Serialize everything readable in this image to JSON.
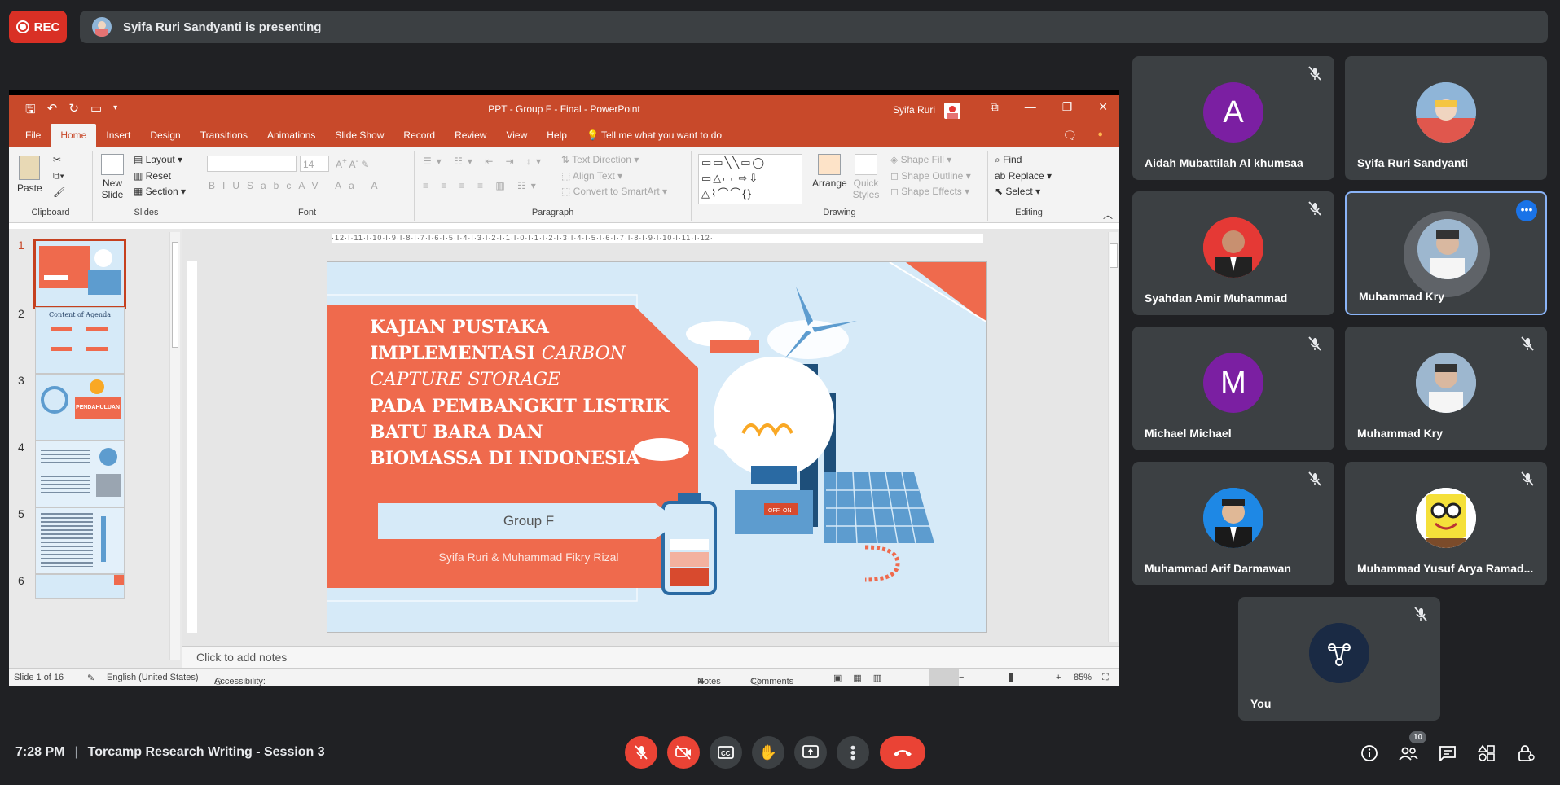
{
  "topbar": {
    "rec_label": "REC",
    "presenting_text": "Syifa Ruri Sandyanti is presenting"
  },
  "ppt": {
    "window_title": "PPT - Group F - Final  -  PowerPoint",
    "user_name": "Syifa Ruri",
    "tabs": [
      "File",
      "Home",
      "Insert",
      "Design",
      "Transitions",
      "Animations",
      "Slide Show",
      "Record",
      "Review",
      "View",
      "Help"
    ],
    "tell_me": "Tell me what you want to do",
    "ribbon": {
      "paste": "Paste",
      "clipboard": "Clipboard",
      "new_slide": "New Slide",
      "layout": "Layout",
      "reset": "Reset",
      "section": "Section",
      "slides": "Slides",
      "font_size": "14",
      "font": "Font",
      "paragraph": "Paragraph",
      "text_direction": "Text Direction",
      "align_text": "Align Text",
      "convert_smartart": "Convert to SmartArt",
      "arrange": "Arrange",
      "quick_styles": "Quick Styles",
      "shape_fill": "Shape Fill",
      "shape_outline": "Shape Outline",
      "shape_effects": "Shape Effects",
      "drawing": "Drawing",
      "find": "Find",
      "replace": "Replace",
      "select": "Select",
      "editing": "Editing"
    },
    "ruler_text": "·12·I·11·I·10·I·9·I·8·I·7·I·6·I·5·I·4·I·3·I·2·I·1·I·0·I·1·I·2·I·3·I·4·I·5·I·6·I·7·I·8·I·9·I·10·I·11·I·12·",
    "thumbnails": [
      "1",
      "2",
      "3",
      "4",
      "5",
      "6"
    ],
    "thumb_text": {
      "t2_title": "Content of Agenda",
      "t3_title": "PENDAHULUAN"
    },
    "slide": {
      "title_line1": "KAJIAN PUSTAKA",
      "title_line2a": "IMPLEMENTASI ",
      "title_line2b": "CARBON",
      "title_line3": "CAPTURE STORAGE",
      "title_line4": "PADA PEMBANGKIT LISTRIK",
      "title_line5": "BATU BARA DAN",
      "title_line6": "BIOMASSA DI INDONESIA",
      "group": "Group F",
      "authors": "Syifa Ruri & Muhammad Fikry Rizal",
      "switch_off": "OFF",
      "switch_on": "ON"
    },
    "notes_placeholder": "Click to add notes",
    "status": {
      "slide_of": "Slide 1 of 16",
      "language": "English (United States)",
      "accessibility": "Accessibility: Investigate",
      "notes": "Notes",
      "comments": "Comments",
      "zoom": "85%"
    }
  },
  "participants": [
    {
      "name": "Aidah Mubattilah Al khumsaa",
      "initial": "A",
      "color": "#7b1fa2",
      "muted": true
    },
    {
      "name": "Syifa Ruri Sandyanti",
      "initial": "",
      "color": "#8fb5d8",
      "muted": false
    },
    {
      "name": "Syahdan Amir Muhammad",
      "initial": "",
      "color": "#e53935",
      "muted": true
    },
    {
      "name": "Muhammad Kry",
      "initial": "",
      "color": "#9db7cf",
      "muted": false
    },
    {
      "name": "Michael Michael",
      "initial": "M",
      "color": "#7b1fa2",
      "muted": true
    },
    {
      "name": "Muhammad Kry",
      "initial": "",
      "color": "#9db7cf",
      "muted": true
    },
    {
      "name": "Muhammad Arif Darmawan",
      "initial": "",
      "color": "#1e88e5",
      "muted": true
    },
    {
      "name": "Muhammad Yusuf Arya Ramad...",
      "initial": "",
      "color": "#f5e03a",
      "muted": true
    },
    {
      "name": "You",
      "initial": "",
      "color": "#1a2a44",
      "muted": true
    }
  ],
  "bottom": {
    "time": "7:28 PM",
    "meeting_title": "Torcamp Research Writing - Session 3",
    "people_count": "10"
  },
  "icons": {
    "mic_off": "mic-off-icon",
    "cam_off": "camera-off-icon",
    "captions": "captions-icon",
    "hand": "raise-hand-icon",
    "present": "present-icon",
    "more": "more-icon",
    "end": "end-call-icon",
    "info": "info-icon",
    "people": "people-icon",
    "chat": "chat-icon",
    "activities": "activities-icon",
    "lock": "host-controls-icon"
  },
  "colors": {
    "meet_bg": "#202124",
    "tile_bg": "#3c4043",
    "ppt_accent": "#c8492a",
    "danger": "#ea4335",
    "slide_orange": "#ef6a4d",
    "slide_bg": "#d6eaf8"
  }
}
